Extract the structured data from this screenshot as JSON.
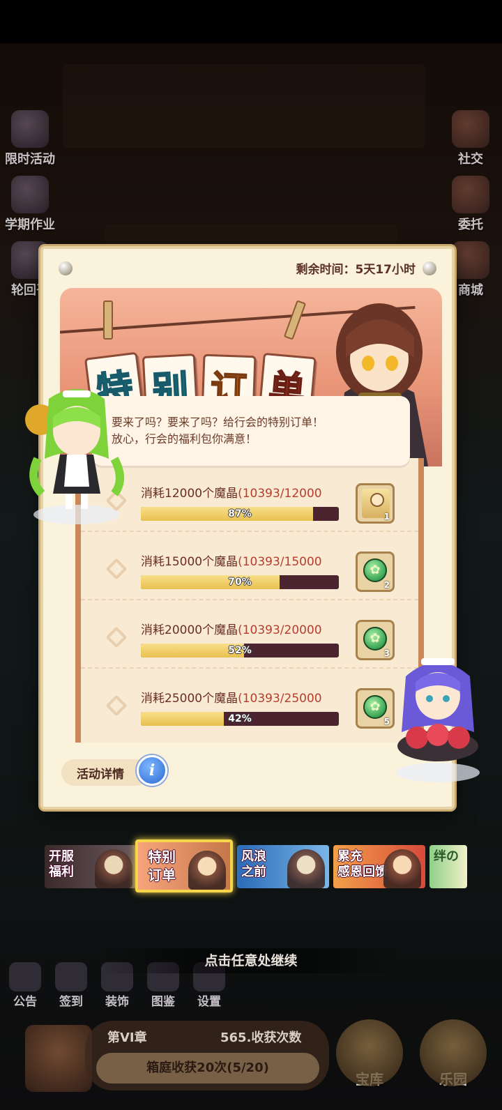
{
  "dialog": {
    "remaining_label": "剩余时间：",
    "remaining_value": "5天17小时",
    "title_chars": [
      "特",
      "别",
      "订",
      "单"
    ],
    "speech_line1": "要来了吗？要来了吗？给行会的特别订单！",
    "speech_line2": "放心，行会的福利包你满意！",
    "tasks": [
      {
        "title": "消耗12000个魔晶",
        "progress": "(10393/12000",
        "percent_label": "87%",
        "percent": 87,
        "reward_count": "1",
        "reward_type": "character-portrait"
      },
      {
        "title": "消耗15000个魔晶",
        "progress": "(10393/15000",
        "percent_label": "70%",
        "percent": 70,
        "reward_count": "2",
        "reward_type": "green-coin-icon"
      },
      {
        "title": "消耗20000个魔晶",
        "progress": "(10393/20000",
        "percent_label": "52%",
        "percent": 52,
        "reward_count": "3",
        "reward_type": "green-coin-icon"
      },
      {
        "title": "消耗25000个魔晶",
        "progress": "(10393/25000",
        "percent_label": "42%",
        "percent": 42,
        "reward_count": "5",
        "reward_type": "green-coin-icon"
      }
    ],
    "detail_label": "活动详情",
    "info_glyph": "i"
  },
  "tabs": [
    {
      "line1": "开服",
      "line2": "福利"
    },
    {
      "line1": "特别",
      "line2": "订单",
      "selected": true
    },
    {
      "line1": "风浪",
      "line2": "之前"
    },
    {
      "line1": "累充",
      "line2": "感恩回馈"
    },
    {
      "line1": "绊の",
      "line2": ""
    }
  ],
  "continue_hint": "点击任意处继续",
  "side_left": [
    {
      "label": "限时活动"
    },
    {
      "label": "学期作业"
    },
    {
      "label": "轮回召"
    }
  ],
  "side_right": [
    {
      "label": "社交"
    },
    {
      "label": "委托"
    },
    {
      "label": "商城"
    }
  ],
  "bottom_nav": [
    {
      "label": "公告"
    },
    {
      "label": "签到"
    },
    {
      "label": "装饰"
    },
    {
      "label": "图鉴"
    },
    {
      "label": "设置"
    }
  ],
  "chapter": {
    "title": "第VI章",
    "count": "565.收获次数",
    "task": "箱庭收获20次(5/20)"
  },
  "big_buttons": {
    "vault": "宝库",
    "park": "乐园"
  },
  "colors": {
    "bar_fill": "#e9c04e",
    "bar_track": "#4b2430",
    "progress_text": "#b83c2e",
    "selected_tab_border": "#f7d54a"
  }
}
